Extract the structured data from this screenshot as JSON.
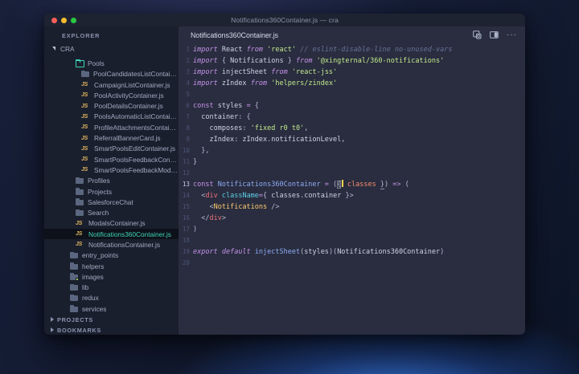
{
  "theme": {
    "editor_bg": "#292d3f",
    "sidebar_bg": "#1a1f2d",
    "titlebar_bg": "#1e2332",
    "selected_row_bg": "#0d1119",
    "selected_row_fg": "#3fd3b8",
    "kw": "#c792ea",
    "str": "#c3e88d",
    "cmt": "#697098",
    "red": "#f07178",
    "yellow": "#ffcb6b",
    "orange": "#f78c6c",
    "blue": "#8fabf5",
    "cyan": "#5ccfe6",
    "punc": "#b4bad2",
    "fg": "#ced3e4",
    "caret": "#ffd04d",
    "gutter": "#4d5477",
    "gutter_active": "#c3cbe8",
    "tree_fg": "#a2abc2",
    "section_fg": "#8b93b0",
    "folder": "#5b6780",
    "folder_open": "#3fd3b8",
    "js_badge": "#ddb45f",
    "close": "#ff5f57",
    "minimize": "#febc2e",
    "zoom": "#28c840",
    "tab_fg": "#d8dce8",
    "title_fg": "#8b93a7",
    "icon_fg": "#aeb6cc"
  },
  "titlebar": {
    "title": "Notifications360Container.js — cra"
  },
  "sidebar": {
    "explorer_label": "EXPLORER",
    "tree": [
      {
        "label": "CRA",
        "type": "root",
        "depth": 0
      },
      {
        "label": "Pools",
        "type": "folder-open",
        "depth": 2
      },
      {
        "label": "PoolCandidatesListContain...",
        "type": "folder",
        "depth": 3
      },
      {
        "label": "CampaignListContainer.js",
        "type": "js",
        "depth": 3
      },
      {
        "label": "PoolActivityContainer.js",
        "type": "js",
        "depth": 3
      },
      {
        "label": "PoolDetailsContainer.js",
        "type": "js",
        "depth": 3
      },
      {
        "label": "PoolsAutomaticListContain...",
        "type": "js",
        "depth": 3
      },
      {
        "label": "ProfileAttachmentsContain...",
        "type": "js",
        "depth": 3
      },
      {
        "label": "ReferralBannerCard.js",
        "type": "js",
        "depth": 3
      },
      {
        "label": "SmartPoolsEditContainer.js",
        "type": "js",
        "depth": 3
      },
      {
        "label": "SmartPoolsFeedbackConta...",
        "type": "js",
        "depth": 3
      },
      {
        "label": "SmartPoolsFeedbackModa...",
        "type": "js",
        "depth": 3
      },
      {
        "label": "Profiles",
        "type": "folder",
        "depth": 2
      },
      {
        "label": "Projects",
        "type": "folder",
        "depth": 2
      },
      {
        "label": "SalesforceChat",
        "type": "folder",
        "depth": 2
      },
      {
        "label": "Search",
        "type": "folder",
        "depth": 2
      },
      {
        "label": "ModalsContainer.js",
        "type": "js",
        "depth": 2
      },
      {
        "label": "Notifications360Container.js",
        "type": "js",
        "depth": 2,
        "selected": true
      },
      {
        "label": "NotificationsContainer.js",
        "type": "js",
        "depth": 2
      },
      {
        "label": "entry_points",
        "type": "folder",
        "depth": 1
      },
      {
        "label": "helpers",
        "type": "folder",
        "depth": 1
      },
      {
        "label": "images",
        "type": "folder-image",
        "depth": 1
      },
      {
        "label": "lib",
        "type": "folder",
        "depth": 1
      },
      {
        "label": "redux",
        "type": "folder",
        "depth": 1
      },
      {
        "label": "services",
        "type": "folder",
        "depth": 1
      }
    ],
    "sections": [
      {
        "label": "PROJECTS"
      },
      {
        "label": "BOOKMARKS"
      }
    ]
  },
  "editor": {
    "tab_label": "Notifications360Container.js",
    "more_actions_glyph": "···",
    "active_line": 13,
    "code": [
      {
        "n": 1,
        "tokens": [
          [
            "import",
            "kwi"
          ],
          [
            " ",
            ""
          ],
          [
            "React",
            ""
          ],
          [
            " ",
            ""
          ],
          [
            "from",
            "kwi"
          ],
          [
            " ",
            ""
          ],
          [
            "'react'",
            "str"
          ],
          [
            " ",
            ""
          ],
          [
            "// eslint-disable-line no-unused-vars",
            "cmt"
          ]
        ]
      },
      {
        "n": 2,
        "tokens": [
          [
            "import",
            "kwi"
          ],
          [
            " ",
            ""
          ],
          [
            "{",
            "punc"
          ],
          [
            " Notifications ",
            ""
          ],
          [
            "}",
            "punc"
          ],
          [
            " ",
            ""
          ],
          [
            "from",
            "kwi"
          ],
          [
            " ",
            ""
          ],
          [
            "'@xingternal/360-notifications'",
            "str"
          ]
        ]
      },
      {
        "n": 3,
        "tokens": [
          [
            "import",
            "kwi"
          ],
          [
            " ",
            ""
          ],
          [
            "injectSheet",
            ""
          ],
          [
            " ",
            ""
          ],
          [
            "from",
            "kwi"
          ],
          [
            " ",
            ""
          ],
          [
            "'react-jss'",
            "str"
          ]
        ]
      },
      {
        "n": 4,
        "tokens": [
          [
            "import",
            "kwi"
          ],
          [
            " ",
            ""
          ],
          [
            "zIndex",
            ""
          ],
          [
            " ",
            ""
          ],
          [
            "from",
            "kwi"
          ],
          [
            " ",
            ""
          ],
          [
            "'helpers/zindex'",
            "str"
          ]
        ]
      },
      {
        "n": 5,
        "tokens": []
      },
      {
        "n": 6,
        "tokens": [
          [
            "const",
            "kw"
          ],
          [
            " styles ",
            ""
          ],
          [
            "=",
            "kw"
          ],
          [
            " ",
            ""
          ],
          [
            "{",
            "punc"
          ]
        ]
      },
      {
        "n": 7,
        "tokens": [
          [
            "  container",
            ""
          ],
          [
            ":",
            "punc"
          ],
          [
            " ",
            ""
          ],
          [
            "{",
            "punc"
          ]
        ]
      },
      {
        "n": 8,
        "tokens": [
          [
            "    composes",
            ""
          ],
          [
            ":",
            "punc"
          ],
          [
            " ",
            ""
          ],
          [
            "'fixed r0 t0'",
            "str"
          ],
          [
            ",",
            "punc"
          ]
        ]
      },
      {
        "n": 9,
        "tokens": [
          [
            "    zIndex",
            ""
          ],
          [
            ":",
            "punc"
          ],
          [
            " zIndex",
            ""
          ],
          [
            ".",
            "punc"
          ],
          [
            "notificationLevel",
            ""
          ],
          [
            ",",
            "punc"
          ]
        ]
      },
      {
        "n": 10,
        "tokens": [
          [
            "  },",
            "punc"
          ]
        ]
      },
      {
        "n": 11,
        "tokens": [
          [
            "}",
            "punc"
          ]
        ]
      },
      {
        "n": 12,
        "tokens": []
      },
      {
        "n": 13,
        "tokens": [
          [
            "const",
            "kw"
          ],
          [
            " ",
            ""
          ],
          [
            "Notifications360Container",
            "blue"
          ],
          [
            " ",
            ""
          ],
          [
            "=",
            "kw"
          ],
          [
            " ",
            ""
          ],
          [
            "(",
            "punc"
          ],
          [
            "{",
            "punc boxed"
          ],
          [
            "",
            "caret"
          ],
          [
            " ",
            ""
          ],
          [
            "classes",
            "orange"
          ],
          [
            " ",
            ""
          ],
          [
            "}",
            "punc underl"
          ],
          [
            ")",
            "punc"
          ],
          [
            " ",
            ""
          ],
          [
            "=>",
            "kw"
          ],
          [
            " ",
            ""
          ],
          [
            "(",
            "punc"
          ]
        ]
      },
      {
        "n": 14,
        "tokens": [
          [
            "  ",
            ""
          ],
          [
            "<",
            "punc"
          ],
          [
            "div",
            "red"
          ],
          [
            " ",
            ""
          ],
          [
            "className",
            "cyan"
          ],
          [
            "=",
            "kw"
          ],
          [
            "{",
            "punc"
          ],
          [
            " classes",
            ""
          ],
          [
            ".",
            "punc"
          ],
          [
            "container",
            ""
          ],
          [
            " ",
            ""
          ],
          [
            "}",
            "punc"
          ],
          [
            ">",
            "punc"
          ]
        ]
      },
      {
        "n": 15,
        "tokens": [
          [
            "    ",
            ""
          ],
          [
            "<",
            "punc"
          ],
          [
            "Notifications",
            "yellow"
          ],
          [
            " ",
            ""
          ],
          [
            "/>",
            "punc"
          ]
        ]
      },
      {
        "n": 16,
        "tokens": [
          [
            "  ",
            ""
          ],
          [
            "</",
            "punc"
          ],
          [
            "div",
            "red"
          ],
          [
            ">",
            "punc"
          ]
        ]
      },
      {
        "n": 17,
        "tokens": [
          [
            ")",
            "punc"
          ]
        ]
      },
      {
        "n": 18,
        "tokens": []
      },
      {
        "n": 19,
        "tokens": [
          [
            "export",
            "kwi"
          ],
          [
            " ",
            ""
          ],
          [
            "default",
            "kwi"
          ],
          [
            " ",
            ""
          ],
          [
            "injectSheet",
            "blue"
          ],
          [
            "(",
            "punc"
          ],
          [
            "styles",
            ""
          ],
          [
            ")(",
            "punc"
          ],
          [
            "Notifications360Container",
            ""
          ],
          [
            ")",
            "punc"
          ]
        ]
      },
      {
        "n": 20,
        "tokens": []
      }
    ]
  }
}
